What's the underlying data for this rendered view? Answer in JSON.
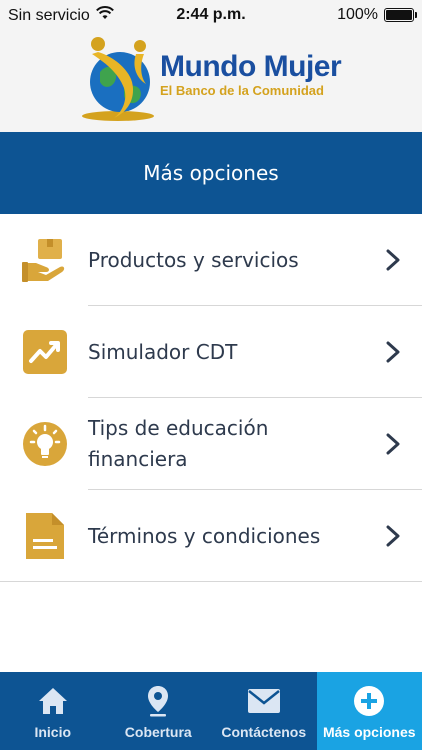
{
  "status_bar": {
    "carrier": "Sin servicio",
    "time": "2:44 p.m.",
    "battery": "100%"
  },
  "logo": {
    "title": "Mundo Mujer",
    "subtitle": "El Banco de la Comunidad"
  },
  "header": {
    "title": "Más opciones"
  },
  "menu": {
    "items": [
      {
        "label": "Productos y servicios",
        "icon": "hand-box-icon"
      },
      {
        "label": "Simulador CDT",
        "icon": "trending-up-icon"
      },
      {
        "label": "Tips de educación financiera",
        "icon": "lightbulb-icon"
      },
      {
        "label": "Términos y condiciones",
        "icon": "document-icon"
      }
    ]
  },
  "tabs": [
    {
      "label": "Inicio",
      "icon": "home-icon",
      "active": false
    },
    {
      "label": "Cobertura",
      "icon": "location-pin-icon",
      "active": false
    },
    {
      "label": "Contáctenos",
      "icon": "mail-icon",
      "active": false
    },
    {
      "label": "Más opciones",
      "icon": "plus-circle-icon",
      "active": true
    }
  ],
  "colors": {
    "primary": "#0d5493",
    "active_tab": "#1aa3e3",
    "icon_gold": "#d9a63a",
    "text": "#2e3a4d"
  }
}
